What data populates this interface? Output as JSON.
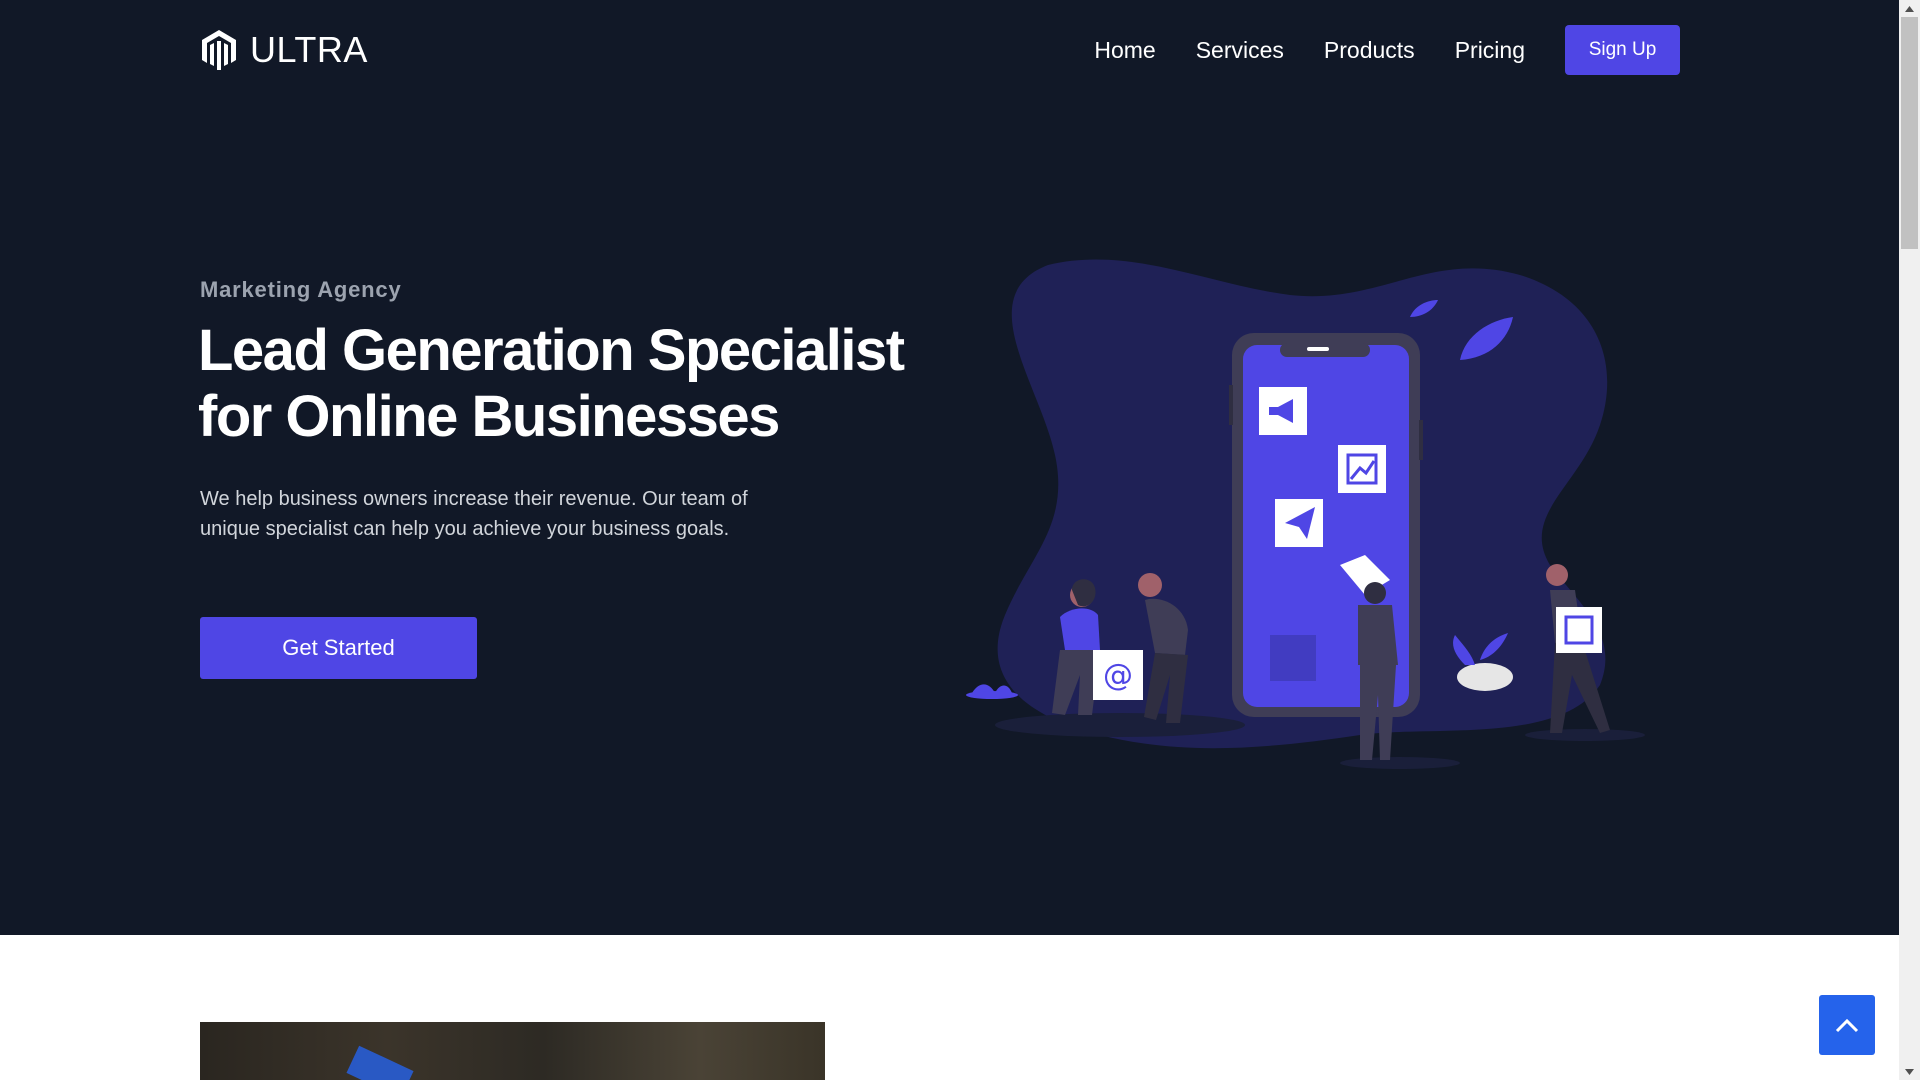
{
  "brand": {
    "name": "ULTRA",
    "icon": "magento-logo-icon"
  },
  "nav": {
    "links": [
      "Home",
      "Services",
      "Products",
      "Pricing"
    ],
    "signup_label": "Sign Up"
  },
  "hero": {
    "eyebrow": "Marketing Agency",
    "headline_line1": "Lead Generation Specialist",
    "headline_line2": "for Online Businesses",
    "description": "We help business owners increase their revenue. Our team of unique specialist can help you achieve your business goals.",
    "cta_label": "Get Started",
    "illustration": "marketing-team-phone-illustration"
  },
  "back_to_top": {
    "icon": "chevron-up-icon"
  },
  "colors": {
    "hero_bg": "#111827",
    "accent": "#4f46e5",
    "back_to_top": "#2563eb"
  }
}
